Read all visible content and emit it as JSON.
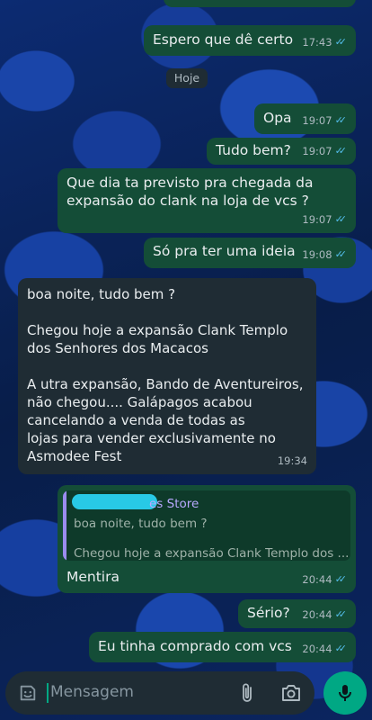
{
  "chat": {
    "date_chip": "Hoje",
    "messages": [
      {
        "direction": "out",
        "text": "Espero que dê certo",
        "time": "17:43",
        "ticks": "✓✓"
      },
      {
        "direction": "out",
        "text": "Opa",
        "time": "19:07",
        "ticks": "✓✓"
      },
      {
        "direction": "out",
        "text": "Tudo bem?",
        "time": "19:07",
        "ticks": "✓✓"
      },
      {
        "direction": "out",
        "text": "Que dia ta previsto pra chegada da\nexpansão do clank na loja de vcs ?",
        "time": "19:07",
        "ticks": "✓✓"
      },
      {
        "direction": "out",
        "text": "Só pra ter uma ideia",
        "time": "19:08",
        "ticks": "✓✓"
      },
      {
        "direction": "in",
        "text": "boa noite, tudo bem ?\n\nChegou hoje a expansão Clank Templo\ndos Senhores dos Macacos\n\nA utra expansão, Bando de Aventureiros,\nnão chegou.... Galápagos acabou\ncancelando a venda de todas as\nlojas para vender exclusivamente no\nAsmodee Fest",
        "time": "19:34"
      },
      {
        "direction": "out",
        "reply": {
          "sender": "es Store",
          "line1": "boa noite, tudo bem ?",
          "line2": "Chegou hoje a expansão Clank Templo dos ..."
        },
        "text": "Mentira",
        "time": "20:44",
        "ticks": "✓✓"
      },
      {
        "direction": "out",
        "text": "Sério?",
        "time": "20:44",
        "ticks": "✓✓"
      },
      {
        "direction": "out",
        "text": "Eu tinha comprado com vcs",
        "time": "20:44",
        "ticks": "✓✓"
      }
    ]
  },
  "composer": {
    "placeholder": "Mensagem",
    "emoji_icon": "emoji-sticker-icon",
    "attach_icon": "paperclip-icon",
    "camera_icon": "camera-icon",
    "mic_icon": "microphone-icon"
  },
  "colors": {
    "outgoing_bubble": "#144d37",
    "incoming_bubble": "#1f2c34",
    "read_ticks": "#53bdeb",
    "accent": "#00a884"
  }
}
